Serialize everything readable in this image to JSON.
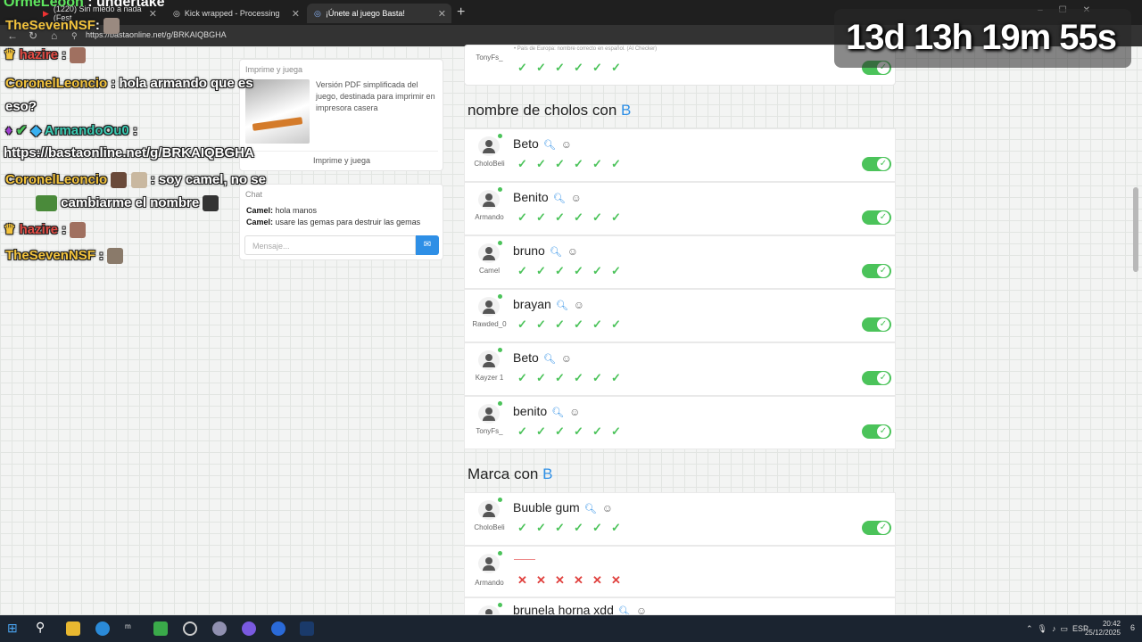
{
  "browser": {
    "tabs": [
      {
        "label": "(1220) Sin miedo a nada (Fest",
        "active": false
      },
      {
        "label": "Kick wrapped - Processing",
        "active": false
      },
      {
        "label": "¡Únete al juego Basta!",
        "active": true
      }
    ],
    "url": "https://bastaonline.net/g/BRKAIQBGHA"
  },
  "stream": {
    "title_user": "OrmeLeoon",
    "title_text": ": undertake",
    "timer": "13d 13h 19m 55s",
    "chat": [
      {
        "user": "TheSevenNSF",
        "text": ":"
      },
      {
        "user": "hazire",
        "text": ":"
      },
      {
        "user": "CoronelLeoncio",
        "text": ": hola armando que es eso?"
      },
      {
        "user": "ArmandoOu0",
        "text": ":"
      },
      {
        "user": "",
        "text": "https://bastaonline.net/g/BRKAIQBGHA"
      },
      {
        "user": "CoronelLeoncio",
        "text": ": soy camel, no se"
      },
      {
        "user": "",
        "text": "cambiarme el nombre"
      },
      {
        "user": "hazire",
        "text": ":"
      },
      {
        "user": "TheSevenNSF",
        "text": ":"
      }
    ]
  },
  "sidebar": {
    "print": {
      "title": "Imprime y juega",
      "description": "Versión PDF simplificada del juego, destinada para imprimir en impresora casera",
      "button": "Imprime y juega"
    },
    "chat": {
      "title": "Chat",
      "messages": [
        {
          "user": "Camel:",
          "text": "hola manos"
        },
        {
          "user": "Camel:",
          "text": "usare las gemas para destruir las gemas"
        }
      ],
      "placeholder": "Mensaje..."
    }
  },
  "top_partial": {
    "player": "TonyFs_",
    "note": "• País de Europa: nombre correcto en español. (AI Checker)"
  },
  "sections": [
    {
      "title": "nombre de cholos con",
      "letter": "B",
      "answers": [
        {
          "word": "Beto",
          "player": "CholoBeli",
          "votes": "ok"
        },
        {
          "word": "Benito",
          "player": "Armando",
          "votes": "ok"
        },
        {
          "word": "bruno",
          "player": "Camel",
          "votes": "ok"
        },
        {
          "word": "brayan",
          "player": "Rawded_0",
          "votes": "ok"
        },
        {
          "word": "Beto",
          "player": "Kayzer 1",
          "votes": "ok"
        },
        {
          "word": "benito",
          "player": "TonyFs_",
          "votes": "ok"
        }
      ]
    },
    {
      "title": "Marca con",
      "letter": "B",
      "answers": [
        {
          "word": "Buuble gum",
          "player": "CholoBeli",
          "votes": "ok"
        },
        {
          "word": "",
          "player": "Armando",
          "votes": "no"
        },
        {
          "word": "brunela horna xdd",
          "player": "",
          "votes": "ok"
        }
      ]
    }
  ],
  "icons": {
    "search": "magnifier-icon",
    "emoji": "smile-icon",
    "check": "check-icon",
    "cross": "cross-icon"
  },
  "system": {
    "lang": "ESP",
    "time": "20:42",
    "date": "25/12/2025",
    "notif": "6"
  },
  "colors": {
    "accent": "#2e8fe6",
    "ok": "#4bc35a",
    "no": "#e0413e"
  }
}
